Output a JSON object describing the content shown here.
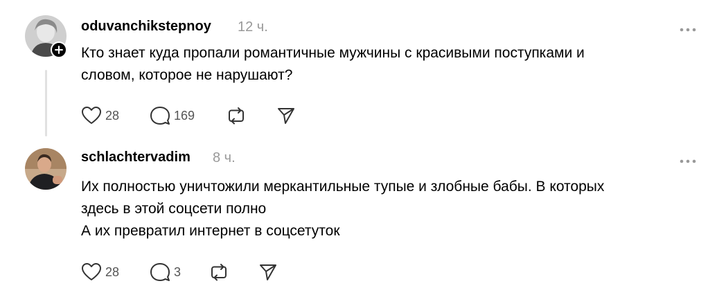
{
  "posts": [
    {
      "username": "oduvanchikstepnoy",
      "time": "12 ч.",
      "lines": [
        "Кто знает куда пропали романтичные мужчины с красивыми поступками и",
        "словом, которое не нарушают?"
      ],
      "likes": "28",
      "replies": "169"
    },
    {
      "username": "schlachtervadim",
      "time": "8 ч.",
      "lines": [
        "Их полностью уничтожили меркантильные тупые и злобные бабы. В которых",
        "здесь в этой соцсети полно",
        "А их превратил интернет в соцсетуток"
      ],
      "likes": "28",
      "replies": "3"
    }
  ],
  "icons": {
    "like": "heart-icon",
    "reply": "comment-icon",
    "repost": "repost-icon",
    "share": "send-icon",
    "more": "more-icon",
    "follow": "plus-icon"
  },
  "colors": {
    "text": "#000000",
    "muted": "#999999",
    "thread_line": "#e1e1e1"
  }
}
